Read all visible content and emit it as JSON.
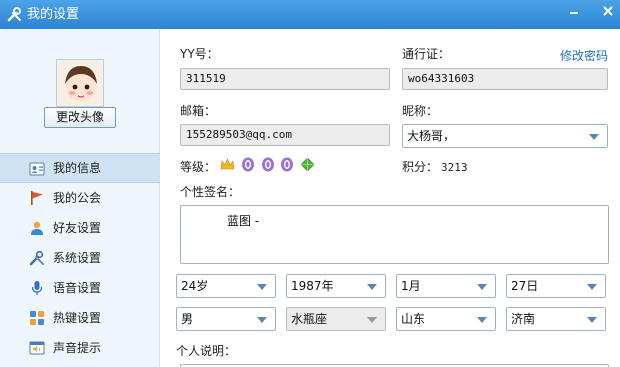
{
  "window": {
    "title": "我的设置"
  },
  "sidebar": {
    "change_avatar_label": "更改头像",
    "items": [
      {
        "label": "我的信息",
        "icon": "profile-card-icon"
      },
      {
        "label": "我的公会",
        "icon": "flag-icon"
      },
      {
        "label": "好友设置",
        "icon": "user-icon"
      },
      {
        "label": "系统设置",
        "icon": "tools-icon"
      },
      {
        "label": "语音设置",
        "icon": "voice-icon"
      },
      {
        "label": "热键设置",
        "icon": "hotkey-icon"
      },
      {
        "label": "声音提示",
        "icon": "sound-icon"
      }
    ]
  },
  "form": {
    "yy_label": "YY号：",
    "yy_value": "311519",
    "passport_label": "通行证：",
    "passport_value": "wo64331603",
    "change_password": "修改密码",
    "email_label": "邮箱：",
    "email_value": "155289503@qq.com",
    "nickname_label": "昵称：",
    "nickname_value": "大杨哥，",
    "level_label": "等级：",
    "points_label": "积分：",
    "points_value": "3213",
    "signature_label": "个性签名：",
    "signature_value": "蓝图  -",
    "age": "24岁",
    "year": "1987年",
    "month": "1月",
    "day": "27日",
    "gender": "男",
    "zodiac": "水瓶座",
    "province": "山东",
    "city": "济南",
    "intro_label": "个人说明："
  },
  "colors": {
    "titlebar": "#2d83d2",
    "sidebar_bg": "#eef5fb",
    "link": "#1f6fc2",
    "level_crown": "#f2b71f",
    "level_badge": "#9a72d6",
    "level_gem": "#4fb13c"
  }
}
